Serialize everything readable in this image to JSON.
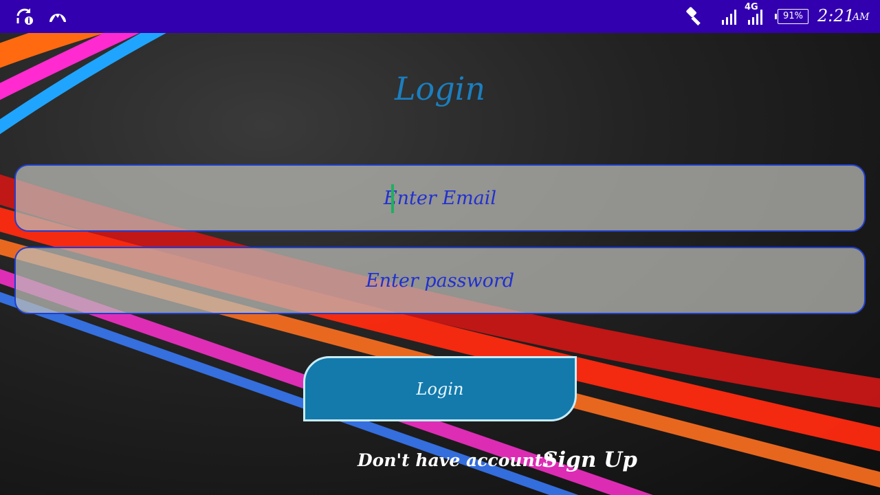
{
  "status_bar": {
    "icons": [
      "sync-info-icon",
      "vpn-mountain-icon",
      "flashlight-icon",
      "signal-icon",
      "signal-4g-icon"
    ],
    "network_label": "4G",
    "battery": "91%",
    "time": "2:21",
    "ampm": "AM"
  },
  "login_form": {
    "title": "Login",
    "email_placeholder": "Enter Email",
    "password_placeholder": "Enter password",
    "login_button": "Login",
    "no_account_text": "Don't have account?",
    "signup_link": "Sign Up"
  },
  "colors": {
    "status_bar": "#3300b0",
    "title": "#1a7fc0",
    "field_border": "#1f3fd0",
    "button": "#137aab"
  }
}
